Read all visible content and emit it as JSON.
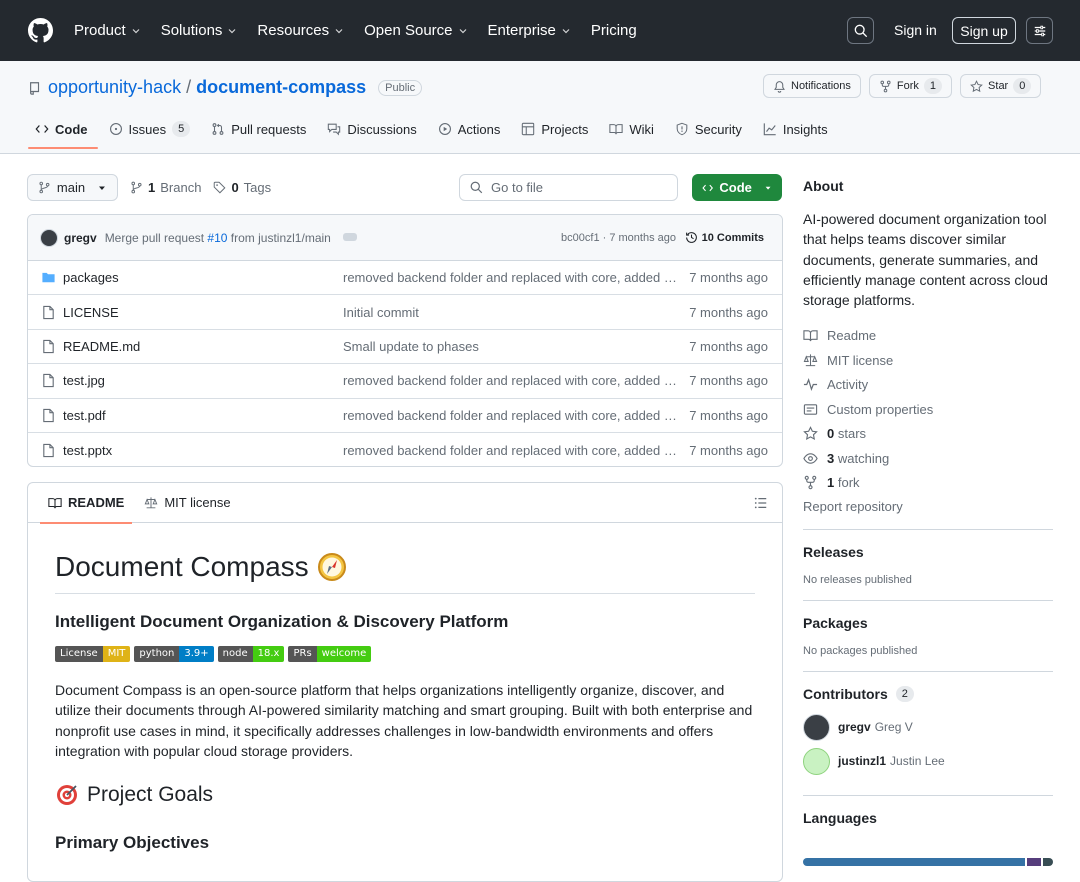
{
  "header": {
    "nav": [
      "Product",
      "Solutions",
      "Resources",
      "Open Source",
      "Enterprise",
      "Pricing"
    ],
    "sign_in": "Sign in",
    "sign_up": "Sign up"
  },
  "repo": {
    "owner": "opportunity-hack",
    "separator": "/",
    "name": "document-compass",
    "visibility": "Public",
    "notifications": "Notifications",
    "fork_label": "Fork",
    "fork_count": "1",
    "star_label": "Star",
    "star_count": "0"
  },
  "tabs": [
    {
      "label": "Code",
      "icon": "code-icon"
    },
    {
      "label": "Issues",
      "icon": "issue-icon",
      "count": "5"
    },
    {
      "label": "Pull requests",
      "icon": "pull-request-icon"
    },
    {
      "label": "Discussions",
      "icon": "discussions-icon"
    },
    {
      "label": "Actions",
      "icon": "play-icon"
    },
    {
      "label": "Projects",
      "icon": "table-icon"
    },
    {
      "label": "Wiki",
      "icon": "book-icon"
    },
    {
      "label": "Security",
      "icon": "shield-icon"
    },
    {
      "label": "Insights",
      "icon": "graph-icon"
    }
  ],
  "branch": {
    "name": "main",
    "branches_count": "1",
    "branches_label": "Branch",
    "tags_count": "0",
    "tags_label": "Tags",
    "goto_placeholder": "Go to file",
    "code_button": "Code"
  },
  "commit": {
    "user": "gregv",
    "message_prefix": "Merge pull request",
    "pr": "#10",
    "message_suffix": "from justinzl1/main",
    "hash_time": "bc00cf1 · 7 months ago",
    "commits": "10 Commits"
  },
  "files": [
    {
      "name": "packages",
      "type": "folder",
      "message": "removed backend folder and replaced with core, added …",
      "date": "7 months ago"
    },
    {
      "name": "LICENSE",
      "type": "file",
      "message": "Initial commit",
      "date": "7 months ago"
    },
    {
      "name": "README.md",
      "type": "file",
      "message": "Small update to phases",
      "date": "7 months ago"
    },
    {
      "name": "test.jpg",
      "type": "file",
      "message": "removed backend folder and replaced with core, added …",
      "date": "7 months ago"
    },
    {
      "name": "test.pdf",
      "type": "file",
      "message": "removed backend folder and replaced with core, added …",
      "date": "7 months ago"
    },
    {
      "name": "test.pptx",
      "type": "file",
      "message": "removed backend folder and replaced with core, added …",
      "date": "7 months ago"
    }
  ],
  "readme": {
    "tab_readme": "README",
    "tab_license": "MIT license",
    "title": "Document Compass",
    "subtitle": "Intelligent Document Organization & Discovery Platform",
    "badges": [
      {
        "left": "License",
        "right": "MIT",
        "color": "#dfb317"
      },
      {
        "left": "python",
        "right": "3.9+",
        "color": "#007ec6"
      },
      {
        "left": "node",
        "right": "18.x",
        "color": "#4c1"
      },
      {
        "left": "PRs",
        "right": "welcome",
        "color": "#4c1"
      }
    ],
    "intro": "Document Compass is an open-source platform that helps organizations intelligently organize, discover, and utilize their documents through AI-powered similarity matching and smart grouping. Built with both enterprise and nonprofit use cases in mind, it specifically addresses challenges in low-bandwidth environments and offers integration with popular cloud storage providers.",
    "goals_heading": "Project Goals",
    "objectives_heading": "Primary Objectives"
  },
  "sidebar": {
    "about_heading": "About",
    "about_text": "AI-powered document organization tool that helps teams discover similar documents, generate summaries, and efficiently manage content across cloud storage platforms.",
    "links": [
      {
        "icon": "book-icon",
        "label": "Readme"
      },
      {
        "icon": "law-icon",
        "label": "MIT license"
      },
      {
        "icon": "pulse-icon",
        "label": "Activity"
      },
      {
        "icon": "note-icon",
        "label": "Custom properties"
      },
      {
        "icon": "star-icon",
        "count": "0",
        "label": "stars"
      },
      {
        "icon": "eye-icon",
        "count": "3",
        "label": "watching"
      },
      {
        "icon": "fork-icon",
        "count": "1",
        "label": "fork"
      }
    ],
    "report": "Report repository",
    "releases_heading": "Releases",
    "releases_text": "No releases published",
    "packages_heading": "Packages",
    "packages_text": "No packages published",
    "contributors_heading": "Contributors",
    "contributors_count": "2",
    "contributors": [
      {
        "login": "gregv",
        "name": "Greg V"
      },
      {
        "login": "justinzl1",
        "name": "Justin Lee"
      }
    ],
    "languages_heading": "Languages"
  },
  "colors": {
    "accent": "#0969da",
    "green": "#1f883d",
    "tab_underline": "#fd8c73",
    "header_bg": "#24292f"
  }
}
